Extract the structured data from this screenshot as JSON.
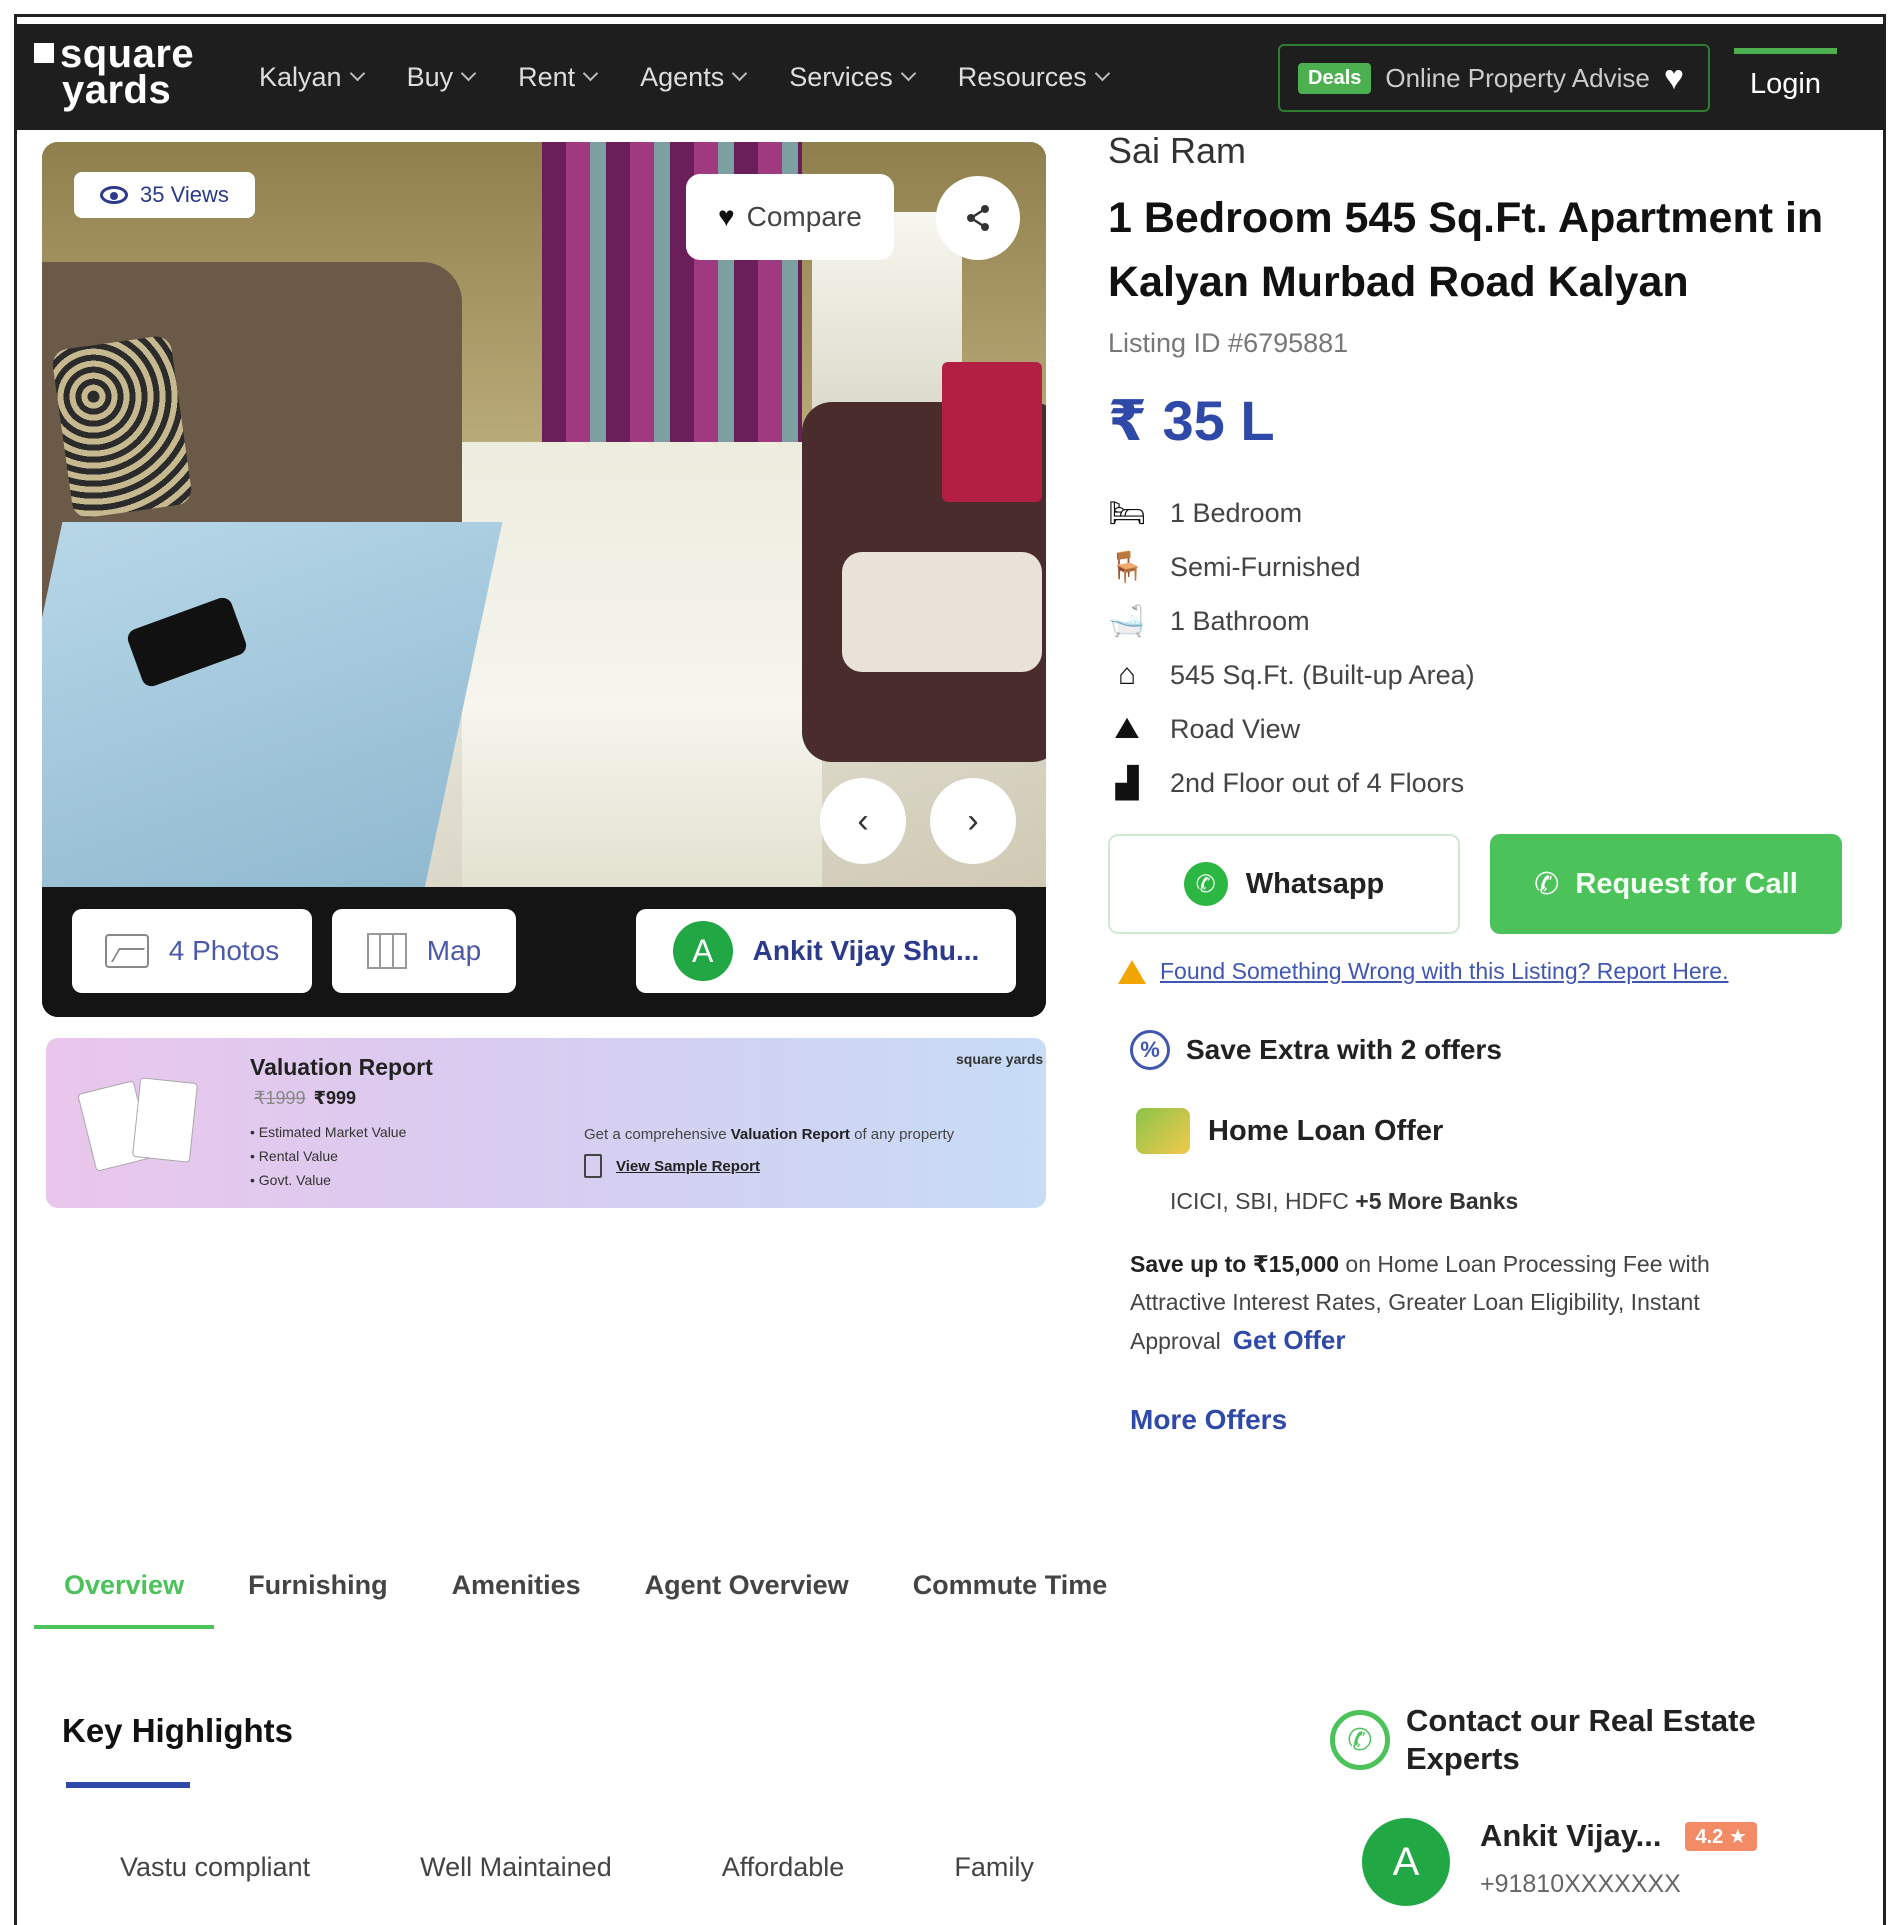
{
  "nav": {
    "logo_line1": "square",
    "logo_line2": "yards",
    "items": [
      {
        "label": "Kalyan"
      },
      {
        "label": "Buy"
      },
      {
        "label": "Rent"
      },
      {
        "label": "Agents"
      },
      {
        "label": "Services"
      },
      {
        "label": "Resources"
      }
    ],
    "promo_badge": "Deals",
    "promo_text": "Online Property Advise",
    "login": "Login"
  },
  "gallery": {
    "views": "35 Views",
    "compare": "Compare",
    "photos": "4 Photos",
    "map": "Map",
    "agent_initial": "A",
    "agent_name": "Ankit Vijay Shu..."
  },
  "valuation": {
    "title": "Valuation Report",
    "old_price": "₹1999",
    "price": "₹999",
    "points": [
      "Estimated Market Value",
      "Rental Value",
      "Govt. Value"
    ],
    "desc_prefix": "Get a comprehensive ",
    "desc_bold": "Valuation Report",
    "desc_suffix": " of any property",
    "link": "View Sample Report",
    "logo": "square yards"
  },
  "listing": {
    "builder": "Sai Ram",
    "title": "1 Bedroom 545 Sq.Ft. Apartment in Kalyan Murbad Road Kalyan",
    "listing_id": "Listing ID #6795881",
    "price": "₹ 35 L",
    "specs": [
      {
        "icon": "bed-icon",
        "label": "1 Bedroom"
      },
      {
        "icon": "sofa-icon",
        "label": "Semi-Furnished"
      },
      {
        "icon": "bathtub-icon",
        "label": "1 Bathroom"
      },
      {
        "icon": "home-icon",
        "label": "545 Sq.Ft. (Built-up Area)"
      },
      {
        "icon": "road-view-icon",
        "label": "Road View"
      },
      {
        "icon": "stairs-icon",
        "label": "2nd Floor out of 4 Floors"
      }
    ],
    "whatsapp": "Whatsapp",
    "request_call": "Request for Call",
    "report": "Found Something Wrong with this Listing? Report Here."
  },
  "offers": {
    "heading": "Save Extra with 2 offers",
    "loan_title": "Home Loan Offer",
    "banks": "ICICI, SBI, HDFC",
    "banks_more": "+5 More Banks",
    "save_bold": "Save up to ₹15,000",
    "save_text": " on Home Loan Processing Fee with Attractive Interest Rates, Greater Loan Eligibility, Instant Approval",
    "get_offer": "Get Offer",
    "more_offers": "More Offers"
  },
  "tabs": [
    "Overview",
    "Furnishing",
    "Amenities",
    "Agent Overview",
    "Commute Time"
  ],
  "highlights": {
    "title": "Key Highlights",
    "items": [
      "Vastu compliant",
      "Well Maintained",
      "Affordable",
      "Family"
    ]
  },
  "contact": {
    "title": "Contact our Real Estate Experts",
    "agent_initial": "A",
    "agent_name": "Ankit Vijay...",
    "rating": "4.2 ★",
    "phone": "+91810XXXXXXX"
  },
  "colors": {
    "brand_blue": "#2f49a8",
    "accent_green": "#4cc25a",
    "nav_bg": "#1e1e1e"
  }
}
